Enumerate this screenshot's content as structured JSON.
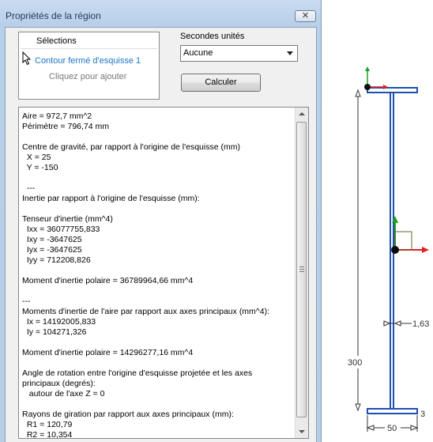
{
  "dialog": {
    "title": "Propriétés de la région",
    "close_glyph": "✕"
  },
  "selections": {
    "header": "Sélections",
    "item": "Contour fermé d'esquisse 1",
    "add_hint": "Cliquez pour ajouter"
  },
  "units": {
    "label": "Secondes unités",
    "value": "Aucune"
  },
  "calc_button": "Calculer",
  "results": {
    "lines": [
      "Aire = 972,7 mm^2",
      "Périmètre = 796,74 mm",
      "",
      "Centre de gravité, par rapport à l'origine de l'esquisse (mm)",
      "  X = 25",
      "  Y = -150",
      "",
      "  ---",
      "Inertie par rapport à l'origine de l'esquisse (mm):",
      "",
      "Tenseur d'inertie (mm^4)",
      "  Ixx = 36077755,833",
      "  Ixy = -3647625",
      "  Iyx = -3647625",
      "  Iyy = 712208,826",
      "",
      "Moment d'inertie polaire = 36789964,66 mm^4",
      "",
      "---",
      "Moments d'inertie de l'aire par rapport aux axes principaux (mm^4):",
      "  Ix = 14192005,833",
      "  Iy = 104271,326",
      "",
      "Moment d'inertie polaire = 14296277,16 mm^4",
      "",
      "Angle de rotation entre l'origine d'esquisse projetée et les axes",
      "principaux (degrés):",
      "   autour de l'axe Z = 0",
      "",
      "Rayons de giration par rapport aux axes principaux (mm):",
      "  R1 = 120,79",
      "  R2 = 10,354"
    ]
  },
  "sketch": {
    "dim_height": "300",
    "dim_width": "50",
    "dim_web": "1,63",
    "dim_cut": "3",
    "profile_color": "#1f4fb0",
    "x_axis_color": "#e02020",
    "y_axis_color": "#20a020"
  }
}
